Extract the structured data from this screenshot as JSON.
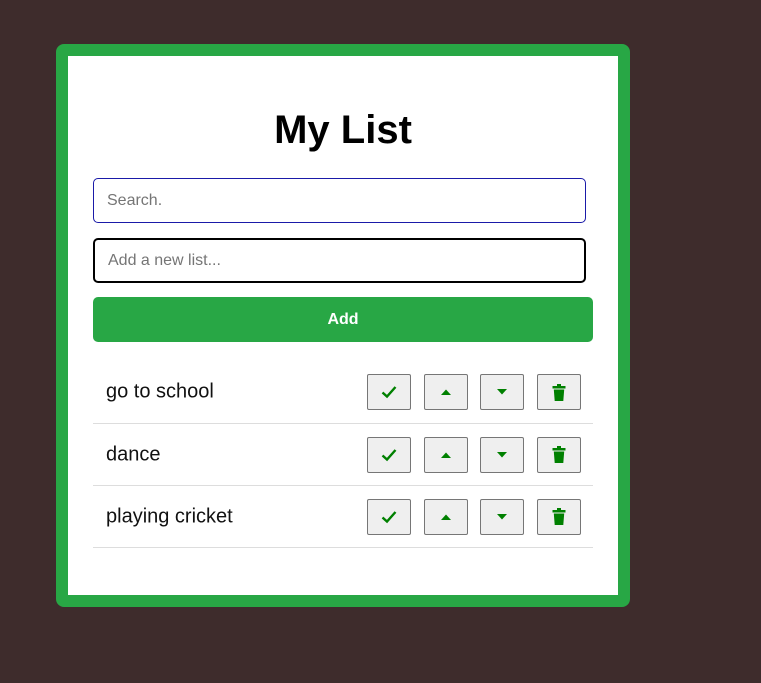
{
  "header": {
    "title": "My List"
  },
  "search": {
    "placeholder": "Search."
  },
  "new_item": {
    "placeholder": "Add a new list...",
    "add_label": "Add"
  },
  "items": [
    {
      "label": "go to school"
    },
    {
      "label": "dance"
    },
    {
      "label": "playing cricket"
    }
  ],
  "icons": {
    "complete": "check-icon",
    "move_up": "caret-up-icon",
    "move_down": "caret-down-icon",
    "delete": "trash-icon"
  },
  "colors": {
    "background": "#3e2c2c",
    "accent": "#28a745",
    "icon": "#008000"
  }
}
